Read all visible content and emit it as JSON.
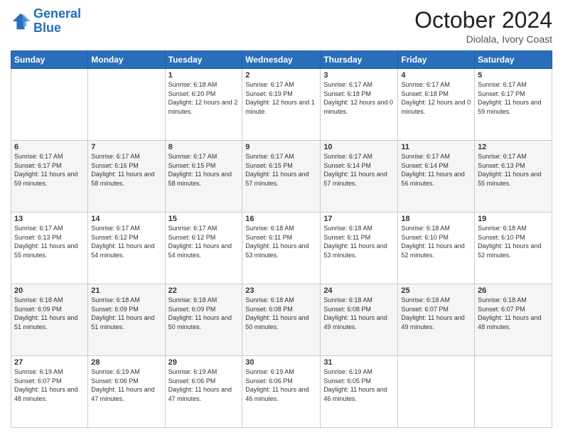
{
  "logo": {
    "text_general": "General",
    "text_blue": "Blue"
  },
  "header": {
    "month": "October 2024",
    "location": "Diolala, Ivory Coast"
  },
  "weekdays": [
    "Sunday",
    "Monday",
    "Tuesday",
    "Wednesday",
    "Thursday",
    "Friday",
    "Saturday"
  ],
  "weeks": [
    [
      {
        "day": "",
        "info": ""
      },
      {
        "day": "",
        "info": ""
      },
      {
        "day": "1",
        "info": "Sunrise: 6:18 AM\nSunset: 6:20 PM\nDaylight: 12 hours and 2 minutes."
      },
      {
        "day": "2",
        "info": "Sunrise: 6:17 AM\nSunset: 6:19 PM\nDaylight: 12 hours and 1 minute."
      },
      {
        "day": "3",
        "info": "Sunrise: 6:17 AM\nSunset: 6:18 PM\nDaylight: 12 hours and 0 minutes."
      },
      {
        "day": "4",
        "info": "Sunrise: 6:17 AM\nSunset: 6:18 PM\nDaylight: 12 hours and 0 minutes."
      },
      {
        "day": "5",
        "info": "Sunrise: 6:17 AM\nSunset: 6:17 PM\nDaylight: 11 hours and 59 minutes."
      }
    ],
    [
      {
        "day": "6",
        "info": "Sunrise: 6:17 AM\nSunset: 6:17 PM\nDaylight: 11 hours and 59 minutes."
      },
      {
        "day": "7",
        "info": "Sunrise: 6:17 AM\nSunset: 6:16 PM\nDaylight: 11 hours and 58 minutes."
      },
      {
        "day": "8",
        "info": "Sunrise: 6:17 AM\nSunset: 6:15 PM\nDaylight: 11 hours and 58 minutes."
      },
      {
        "day": "9",
        "info": "Sunrise: 6:17 AM\nSunset: 6:15 PM\nDaylight: 11 hours and 57 minutes."
      },
      {
        "day": "10",
        "info": "Sunrise: 6:17 AM\nSunset: 6:14 PM\nDaylight: 11 hours and 57 minutes."
      },
      {
        "day": "11",
        "info": "Sunrise: 6:17 AM\nSunset: 6:14 PM\nDaylight: 11 hours and 56 minutes."
      },
      {
        "day": "12",
        "info": "Sunrise: 6:17 AM\nSunset: 6:13 PM\nDaylight: 11 hours and 55 minutes."
      }
    ],
    [
      {
        "day": "13",
        "info": "Sunrise: 6:17 AM\nSunset: 6:13 PM\nDaylight: 11 hours and 55 minutes."
      },
      {
        "day": "14",
        "info": "Sunrise: 6:17 AM\nSunset: 6:12 PM\nDaylight: 11 hours and 54 minutes."
      },
      {
        "day": "15",
        "info": "Sunrise: 6:17 AM\nSunset: 6:12 PM\nDaylight: 11 hours and 54 minutes."
      },
      {
        "day": "16",
        "info": "Sunrise: 6:18 AM\nSunset: 6:11 PM\nDaylight: 11 hours and 53 minutes."
      },
      {
        "day": "17",
        "info": "Sunrise: 6:18 AM\nSunset: 6:11 PM\nDaylight: 11 hours and 53 minutes."
      },
      {
        "day": "18",
        "info": "Sunrise: 6:18 AM\nSunset: 6:10 PM\nDaylight: 11 hours and 52 minutes."
      },
      {
        "day": "19",
        "info": "Sunrise: 6:18 AM\nSunset: 6:10 PM\nDaylight: 11 hours and 52 minutes."
      }
    ],
    [
      {
        "day": "20",
        "info": "Sunrise: 6:18 AM\nSunset: 6:09 PM\nDaylight: 11 hours and 51 minutes."
      },
      {
        "day": "21",
        "info": "Sunrise: 6:18 AM\nSunset: 6:09 PM\nDaylight: 11 hours and 51 minutes."
      },
      {
        "day": "22",
        "info": "Sunrise: 6:18 AM\nSunset: 6:09 PM\nDaylight: 11 hours and 50 minutes."
      },
      {
        "day": "23",
        "info": "Sunrise: 6:18 AM\nSunset: 6:08 PM\nDaylight: 11 hours and 50 minutes."
      },
      {
        "day": "24",
        "info": "Sunrise: 6:18 AM\nSunset: 6:08 PM\nDaylight: 11 hours and 49 minutes."
      },
      {
        "day": "25",
        "info": "Sunrise: 6:18 AM\nSunset: 6:07 PM\nDaylight: 11 hours and 49 minutes."
      },
      {
        "day": "26",
        "info": "Sunrise: 6:18 AM\nSunset: 6:07 PM\nDaylight: 11 hours and 48 minutes."
      }
    ],
    [
      {
        "day": "27",
        "info": "Sunrise: 6:19 AM\nSunset: 6:07 PM\nDaylight: 11 hours and 48 minutes."
      },
      {
        "day": "28",
        "info": "Sunrise: 6:19 AM\nSunset: 6:06 PM\nDaylight: 11 hours and 47 minutes."
      },
      {
        "day": "29",
        "info": "Sunrise: 6:19 AM\nSunset: 6:06 PM\nDaylight: 11 hours and 47 minutes."
      },
      {
        "day": "30",
        "info": "Sunrise: 6:19 AM\nSunset: 6:06 PM\nDaylight: 11 hours and 46 minutes."
      },
      {
        "day": "31",
        "info": "Sunrise: 6:19 AM\nSunset: 6:05 PM\nDaylight: 11 hours and 46 minutes."
      },
      {
        "day": "",
        "info": ""
      },
      {
        "day": "",
        "info": ""
      }
    ]
  ]
}
